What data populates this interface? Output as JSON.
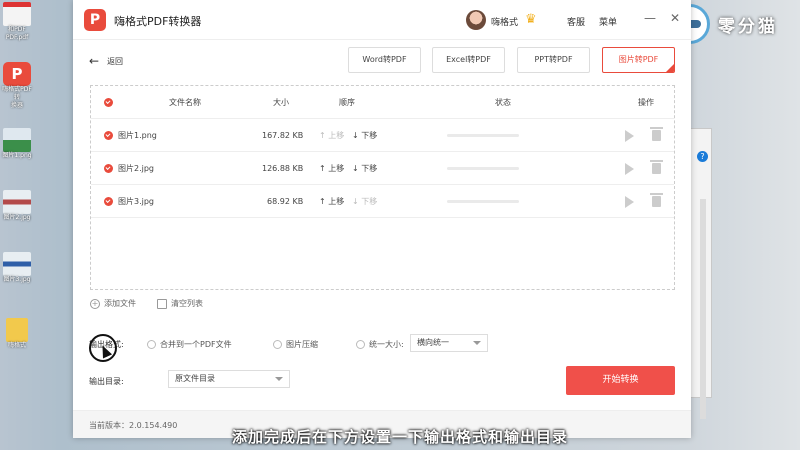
{
  "desktop": {
    "icons": [
      {
        "caption": "和PDF\nPDF.pdf"
      },
      {
        "caption": "嗨格式PDF转\n换器"
      },
      {
        "caption": "图片1.png"
      },
      {
        "caption": "图片2.jpg"
      },
      {
        "caption": "图片3.jpg"
      },
      {
        "caption": "嗨格式"
      }
    ]
  },
  "brand": {
    "text": "零分猫"
  },
  "window": {
    "logo_glyph": "P",
    "title": "嗨格式PDF转换器",
    "user_name": "嗨格式",
    "links": {
      "service": "客服",
      "menu": "菜单"
    },
    "controls": {
      "minimize": "—",
      "close": "✕"
    }
  },
  "back_label": "返回",
  "modes": [
    {
      "label": "Word转PDF",
      "active": false
    },
    {
      "label": "Excel转PDF",
      "active": false
    },
    {
      "label": "PPT转PDF",
      "active": false
    },
    {
      "label": "图片转PDF",
      "active": true
    }
  ],
  "table": {
    "headers": {
      "name": "文件名称",
      "size": "大小",
      "order": "顺序",
      "status": "状态",
      "action": "操作"
    },
    "move_up": "↑ 上移",
    "move_down": "↓ 下移",
    "rows": [
      {
        "name": "图片1.png",
        "size": "167.82 KB",
        "up_enabled": false,
        "down_enabled": true
      },
      {
        "name": "图片2.jpg",
        "size": "126.88 KB",
        "up_enabled": true,
        "down_enabled": true
      },
      {
        "name": "图片3.jpg",
        "size": "68.92 KB",
        "up_enabled": true,
        "down_enabled": false
      }
    ]
  },
  "actions": {
    "add_file": "添加文件",
    "clear_list": "清空列表"
  },
  "output_format": {
    "label": "输出格式:",
    "options": [
      {
        "label": "合并到一个PDF文件"
      },
      {
        "label": "图片压缩"
      },
      {
        "label": "统一大小:"
      }
    ],
    "size_select": "横向统一"
  },
  "output_dir": {
    "label": "输出目录:",
    "value": "原文件目录"
  },
  "start_button": "开始转换",
  "version": "当前版本：2.0.154.490",
  "subtitle": "添加完成后在下方设置一下输出格式和输出目录",
  "colors": {
    "accent": "#e94b3c",
    "start": "#f0504a"
  }
}
